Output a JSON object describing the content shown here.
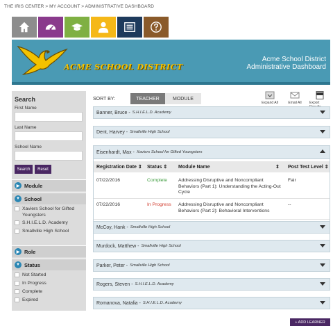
{
  "breadcrumb": "THE IRIS CENTER > MY ACCOUNT > ADMINISTRATIVE DASHBOARD",
  "nav_tabs": [
    {
      "icon": "home-icon",
      "color": "#8d8d8d"
    },
    {
      "icon": "dashboard-icon",
      "color": "#8a3a8c"
    },
    {
      "icon": "graduation-cap-icon",
      "color": "#7fb043"
    },
    {
      "icon": "user-icon",
      "color": "#f5b818"
    },
    {
      "icon": "list-icon",
      "color": "#1e3a5c"
    },
    {
      "icon": "help-icon",
      "color": "#8a5a2a"
    }
  ],
  "banner": {
    "logo_text": "ACME SCHOOL DISTRICT",
    "line1": "Acme School District",
    "line2": "Administrative Dashboard"
  },
  "sidebar": {
    "search_heading": "Search",
    "first_name_label": "First Name",
    "last_name_label": "Last Name",
    "school_name_label": "School Name",
    "search_button": "Search",
    "reset_button": "Reset",
    "facets": {
      "module": "Module",
      "school": "School",
      "school_items": [
        "Xaviers School for Gifted Youngsters",
        "S.H.I.E.L.D. Academy",
        "Smallville High School"
      ],
      "role": "Role",
      "status": "Status",
      "status_items": [
        "Not Started",
        "In Progress",
        "Complete",
        "Expired"
      ]
    }
  },
  "sort": {
    "label": "SORT BY:",
    "teacher": "TEACHER",
    "module": "MODULE"
  },
  "actions": {
    "expand_all": "Expand All",
    "email_all": "Email All",
    "export_results": "Export Results"
  },
  "teachers": [
    {
      "name": "Banner, Bruce",
      "school": "S.H.I.E.L.D. Academy"
    },
    {
      "name": "Dent, Harvey",
      "school": "Smallville High School"
    },
    {
      "name": "Eisenhardt, Max",
      "school": "Xaviers School for Gifted Youngsters"
    },
    {
      "name": "McCoy, Hank",
      "school": "Smallville High School"
    },
    {
      "name": "Murdock, Matthew",
      "school": "Smallville High School"
    },
    {
      "name": "Parker, Peter",
      "school": "Smallville High School"
    },
    {
      "name": "Rogers, Steven",
      "school": "S.H.I.E.L.D. Academy"
    },
    {
      "name": "Romanova, Natalia",
      "school": "S.H.I.E.L.D. Academy"
    }
  ],
  "table": {
    "headers": [
      "Registration Date",
      "Status",
      "Module Name",
      "Post Test Level"
    ],
    "rows": [
      {
        "date": "07/22/2016",
        "status": "Complete",
        "module": "Addressing Disruptive and Noncompliant Behaviors (Part 1): Understanding the Acting-Out Cycle",
        "level": "Fair"
      },
      {
        "date": "07/22/2016",
        "status": "In Progress",
        "module": "Addressing Disruptive and Noncompliant Behaviors (Part 2): Behavioral Interventions",
        "level": "--"
      }
    ]
  },
  "add_learner": "+ ADD LEARNER",
  "colors": {
    "banner": "#4a9ab4",
    "purple": "#4a2763",
    "row_bg": "#dfe9ef",
    "accent_blue": "#2b87b4"
  }
}
